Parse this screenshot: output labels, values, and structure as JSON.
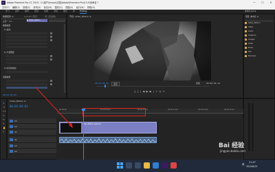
{
  "window": {
    "title": "Adobe Premiere Pro CC 2019 - C:\\用户\\lenovo\\文档\\Adobe\\Premiere Pro\\13.0\\未命名 *",
    "minimize": "—",
    "maximize": "☐",
    "close": "✕"
  },
  "menu": {
    "items": [
      "文件(F)",
      "编辑(E)",
      "剪辑(C)",
      "序列(S)",
      "标记(M)",
      "图形(G)",
      "视图(V)",
      "窗口(W)",
      "帮助(H)"
    ]
  },
  "workspace_tabs": [
    "学习",
    "组件",
    "编辑",
    "颜色",
    "效果",
    "音频",
    "图形",
    "库",
    "Editing"
  ],
  "source_panel": {
    "tab": "效果控件 ≡",
    "tab2": "Lumetri 范围",
    "tab3": "源: (无剪辑)",
    "clip_label": "主要 * Vid ...",
    "clip_chip": "▶ Video_Motio...",
    "sections": [
      "视频效果",
      "fx 运动",
      "fx 不透明度",
      "fx 时间重映射",
      "音频效果"
    ],
    "timecode": "00:01:04:03"
  },
  "program_panel": {
    "tab": "节目: Video_Motion ≡",
    "timecode_left": "00:00:04:02",
    "fit": "适合",
    "quality": "完整",
    "timecode_right": "00:00:04:14"
  },
  "project_panel": {
    "tab": "项目: 未命名 ≡",
    "items": [
      "未命名.prproj",
      "Video_Motion",
      "Video",
      "Audio",
      "Graphics",
      "Images",
      "Titles",
      "Music",
      "SFX",
      "Backups"
    ]
  },
  "timeline": {
    "tab": "Video_Motion ≡",
    "timecode": "00:01:04:03",
    "ruler_labels": [
      "00:00:00",
      "00:00:05:00",
      "00:00:10:00",
      "00:00:15:00",
      "00:00:20:00",
      "00:00:25:00"
    ],
    "video_tracks": [
      "V3",
      "V2",
      "V1"
    ],
    "audio_tracks": [
      "A1",
      "A2",
      "A3"
    ],
    "clip_label": "Video_Motion.mp4 [V]"
  },
  "taskbar": {
    "time": "21:47",
    "date": "2022/8/25",
    "ime": "英"
  },
  "watermark": {
    "brand": "Bai 经验",
    "url": "jingyan.baidu.com"
  },
  "colors": {
    "accent": "#2d8ceb",
    "annotation": "#e0231a",
    "clip_fill": "#7b7fc4"
  }
}
